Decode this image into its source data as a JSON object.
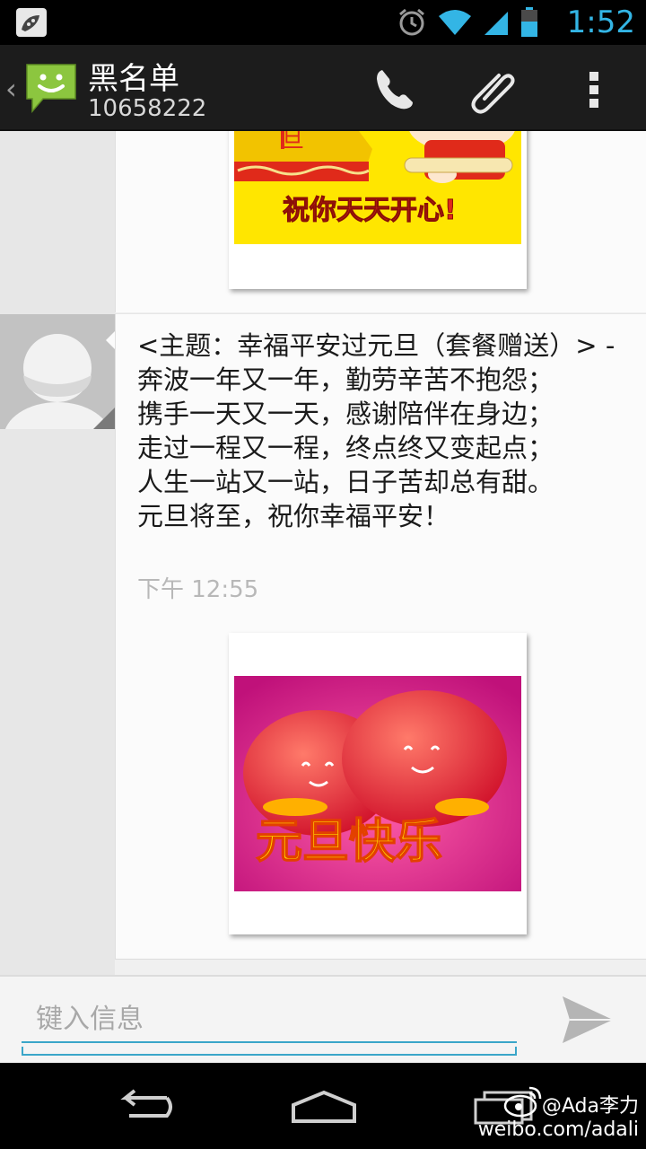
{
  "status_bar": {
    "time": "1:52",
    "accent_color": "#33b5e5"
  },
  "action_bar": {
    "contact_name": "黑名单",
    "contact_number": "10658222",
    "icons": [
      "back-chevron-icon",
      "messaging-app-icon",
      "phone-icon",
      "attachment-icon",
      "overflow-menu-icon"
    ]
  },
  "messages": [
    {
      "type": "mms-image",
      "image_caption": "祝你天天开心!"
    },
    {
      "type": "mms",
      "text": "<主题：幸福平安过元旦（套餐赠送）> - 奔波一年又一年，勤劳辛苦不抱怨；\n携手一天又一天，感谢陪伴在身边；\n走过一程又一程，终点终又变起点；\n人生一站又一站，日子苦却总有甜。\n元旦将至，祝你幸福平安！",
      "time": "下午 12:55",
      "image_caption": "元旦快乐"
    }
  ],
  "compose": {
    "placeholder": "键入信息"
  },
  "watermark": {
    "line1": "@Ada李力",
    "line2": "weibo.com/adali"
  }
}
